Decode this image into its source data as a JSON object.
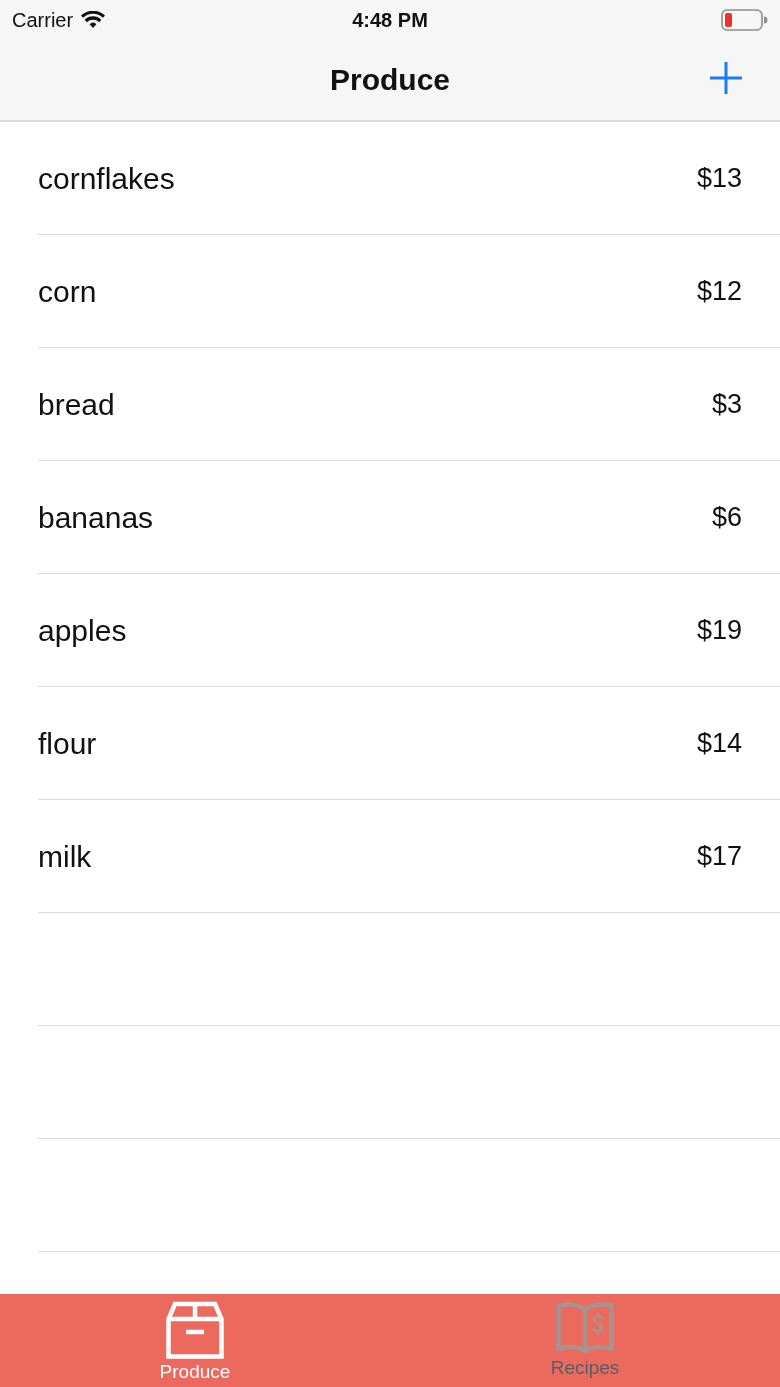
{
  "status_bar": {
    "carrier": "Carrier",
    "time": "4:48 PM"
  },
  "nav_bar": {
    "title": "Produce"
  },
  "items": [
    {
      "name": "cornflakes",
      "price": "$13"
    },
    {
      "name": "corn",
      "price": "$12"
    },
    {
      "name": "bread",
      "price": "$3"
    },
    {
      "name": "bananas",
      "price": "$6"
    },
    {
      "name": "apples",
      "price": "$19"
    },
    {
      "name": "flour",
      "price": "$14"
    },
    {
      "name": "milk",
      "price": "$17"
    }
  ],
  "tab_bar": [
    {
      "label": "Produce",
      "kind": "box",
      "selected": true
    },
    {
      "label": "Recipes",
      "kind": "book",
      "selected": false
    }
  ]
}
